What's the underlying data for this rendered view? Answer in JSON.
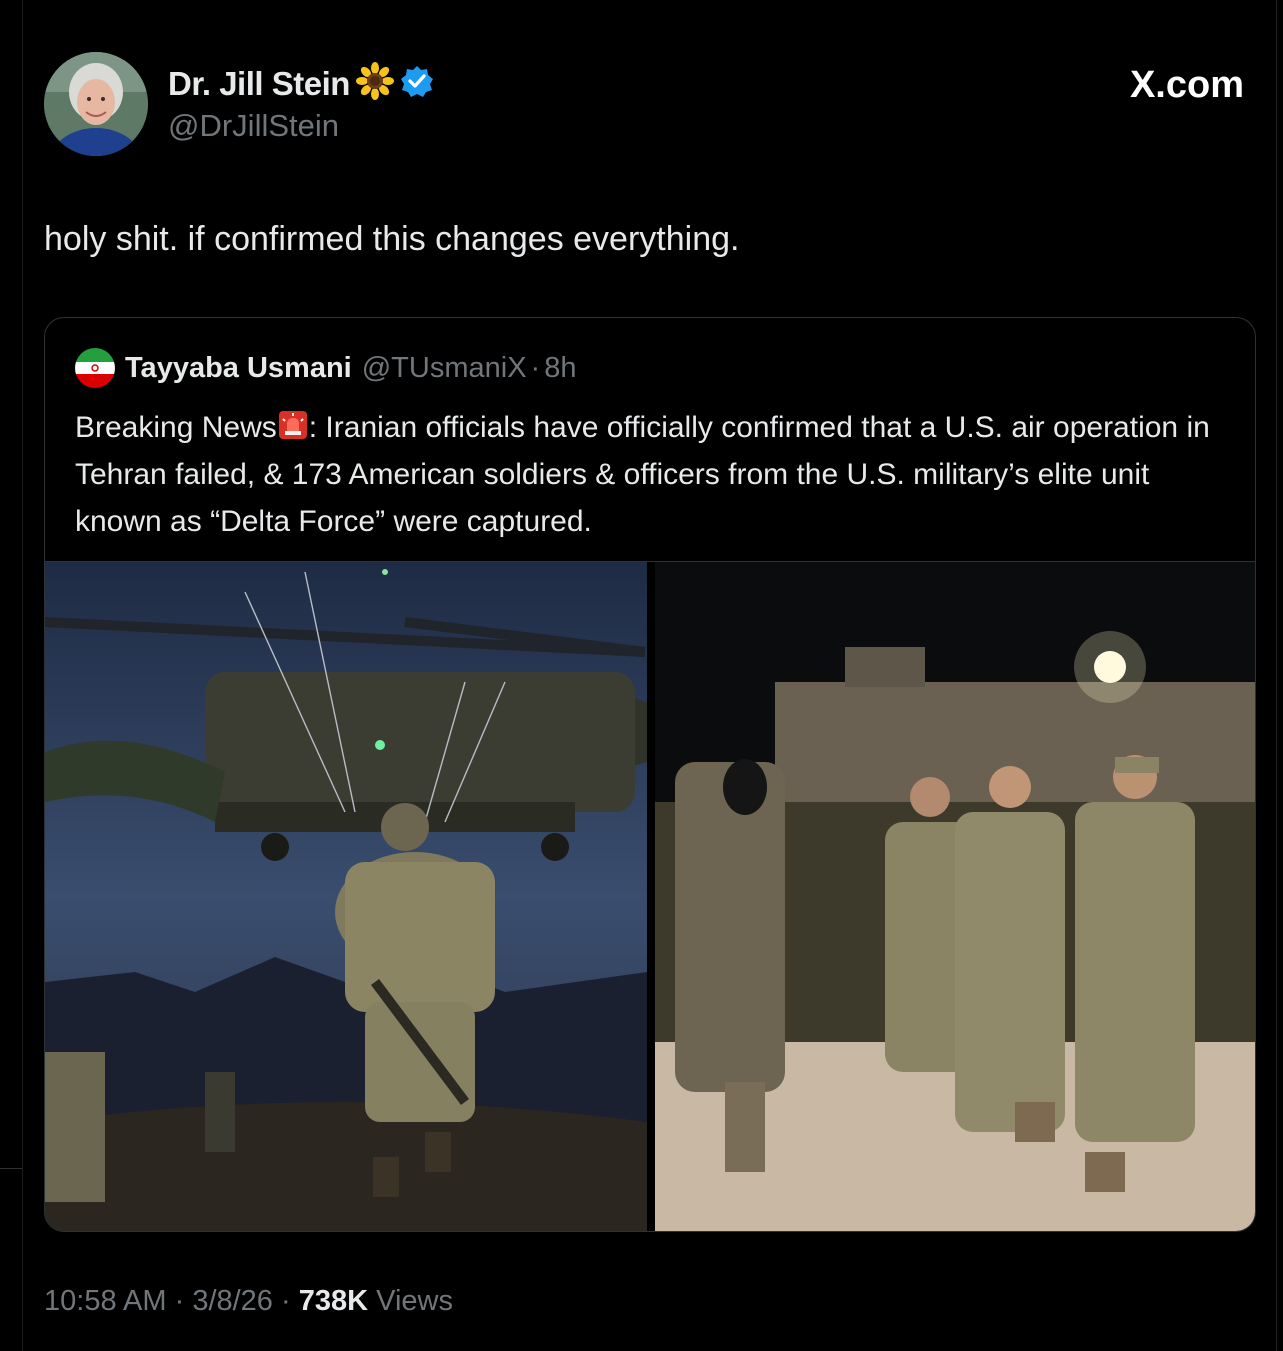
{
  "author": {
    "name": "Dr. Jill Stein",
    "name_emoji": "sunflower",
    "verified": true,
    "handle": "@DrJillStein"
  },
  "site": {
    "label": "X.com"
  },
  "tweet": {
    "text": "holy shit. if confirmed this changes everything."
  },
  "quoted": {
    "flag": "iran-flag",
    "name": "Tayyaba Usmani",
    "handle": "@TUsmaniX",
    "separator": "·",
    "time": "8h",
    "text_before": "Breaking News",
    "text_after": ": Iranian officials have officially confirmed that a U.S. air operation in Tehran failed, & 173 American soldiers & officers from the U.S. military’s elite unit known as “Delta Force” were captured."
  },
  "footer": {
    "time": "10:58 AM",
    "sep1": " · ",
    "date": "3/8/26",
    "sep2": " · ",
    "views_count": "738K",
    "views_label": " Views"
  },
  "colors": {
    "background": "#000000",
    "text": "#e7e9ea",
    "muted": "#71767b",
    "border": "#2f3336",
    "verified": "#1d9bf0"
  }
}
